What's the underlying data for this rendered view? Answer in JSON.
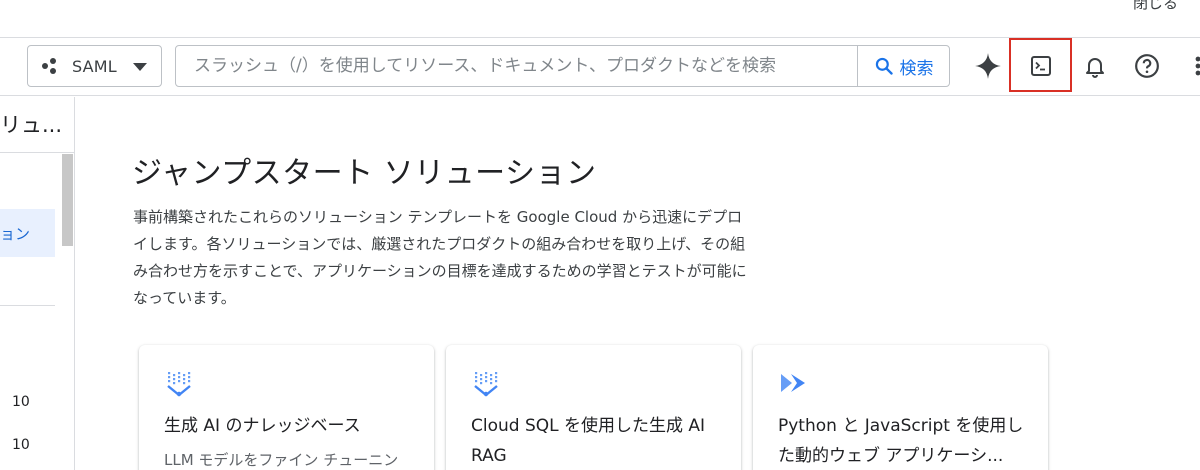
{
  "topbar": {
    "close_label": "閉じる"
  },
  "header": {
    "project_label": "SAML",
    "search_placeholder": "スラッシュ（/）を使用してリソース、ドキュメント、プロダクトなどを検索",
    "search_button_label": "検索",
    "icons": [
      "sparkle-icon",
      "terminal-icon",
      "bell-icon",
      "help-icon",
      "more-vert-icon"
    ],
    "highlight_color": "#d93025"
  },
  "sidebar": {
    "title": "リュ...",
    "active_item": "ョン",
    "counts": [
      "10",
      "10"
    ]
  },
  "main": {
    "title": "ジャンプスタート ソリューション",
    "description": "事前構築されたこれらのソリューション テンプレートを Google Cloud から迅速にデプロイします。各ソリューションでは、厳選されたプロダクトの組み合わせを取り上げ、その組み合わせ方を示すことで、アプリケーションの目標を達成するための学習とテストが可能になっています。",
    "cards": [
      {
        "title": "生成 AI のナレッジベース",
        "subtitle": "LLM モデルをファイン チューニン",
        "icon": "vertex-ai-icon"
      },
      {
        "title": "Cloud SQL を使用した生成 AI RAG",
        "subtitle": "",
        "icon": "vertex-ai-icon"
      },
      {
        "title": "Python と JavaScript を使用した動的ウェブ アプリケーシ...",
        "subtitle": "",
        "icon": "cloud-run-icon"
      }
    ]
  },
  "colors": {
    "accent": "#1a73e8",
    "active_bg": "#e8f0fe",
    "border": "#dadce0"
  }
}
